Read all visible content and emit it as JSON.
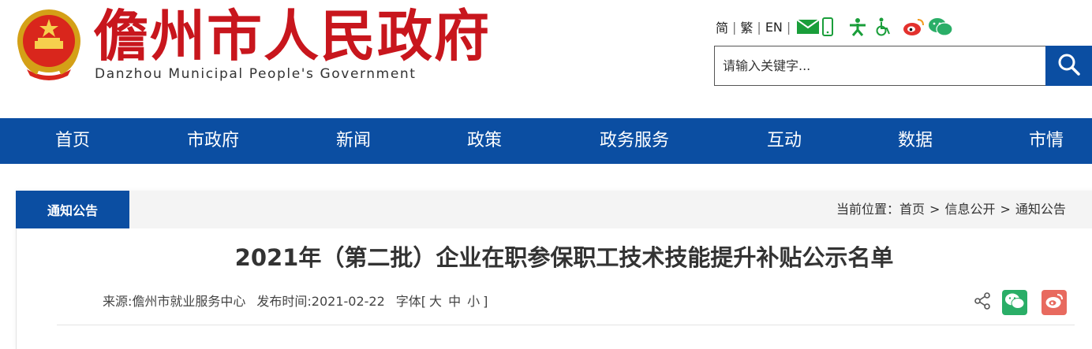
{
  "header": {
    "title": "儋州市人民政府",
    "subtitle": "Danzhou Municipal People's Government",
    "lang_simplified": "简",
    "lang_traditional": "繁",
    "lang_english": "EN",
    "icons": [
      "emblem-icon",
      "mail-icon",
      "mobile-icon",
      "accessibility-icon",
      "wheelchair-icon",
      "weibo-icon",
      "wechat-icon",
      "search-icon"
    ],
    "search": {
      "placeholder": "请输入关键字..."
    }
  },
  "nav": {
    "items": [
      {
        "label": "首页"
      },
      {
        "label": "市政府"
      },
      {
        "label": "新闻"
      },
      {
        "label": "政策"
      },
      {
        "label": "政务服务"
      },
      {
        "label": "互动"
      },
      {
        "label": "数据"
      },
      {
        "label": "市情"
      }
    ]
  },
  "section": {
    "tab_label": "通知公告",
    "breadcrumb": {
      "prefix": "当前位置：",
      "items": [
        "首页",
        "信息公开",
        "通知公告"
      ]
    }
  },
  "article": {
    "title": "2021年（第二批）企业在职参保职工技术技能提升补贴公示名单",
    "source_label": "来源:儋州市就业服务中心",
    "date_label": "发布时间:2021-02-22",
    "font_label": "字体[",
    "font_large": "大",
    "font_medium": "中",
    "font_small": "小",
    "font_close": "]"
  },
  "colors": {
    "brand_red": "#c8161d",
    "nav_blue": "#0b4ea2",
    "wechat_green": "#2aae67",
    "weibo_red": "#e86a5f"
  }
}
